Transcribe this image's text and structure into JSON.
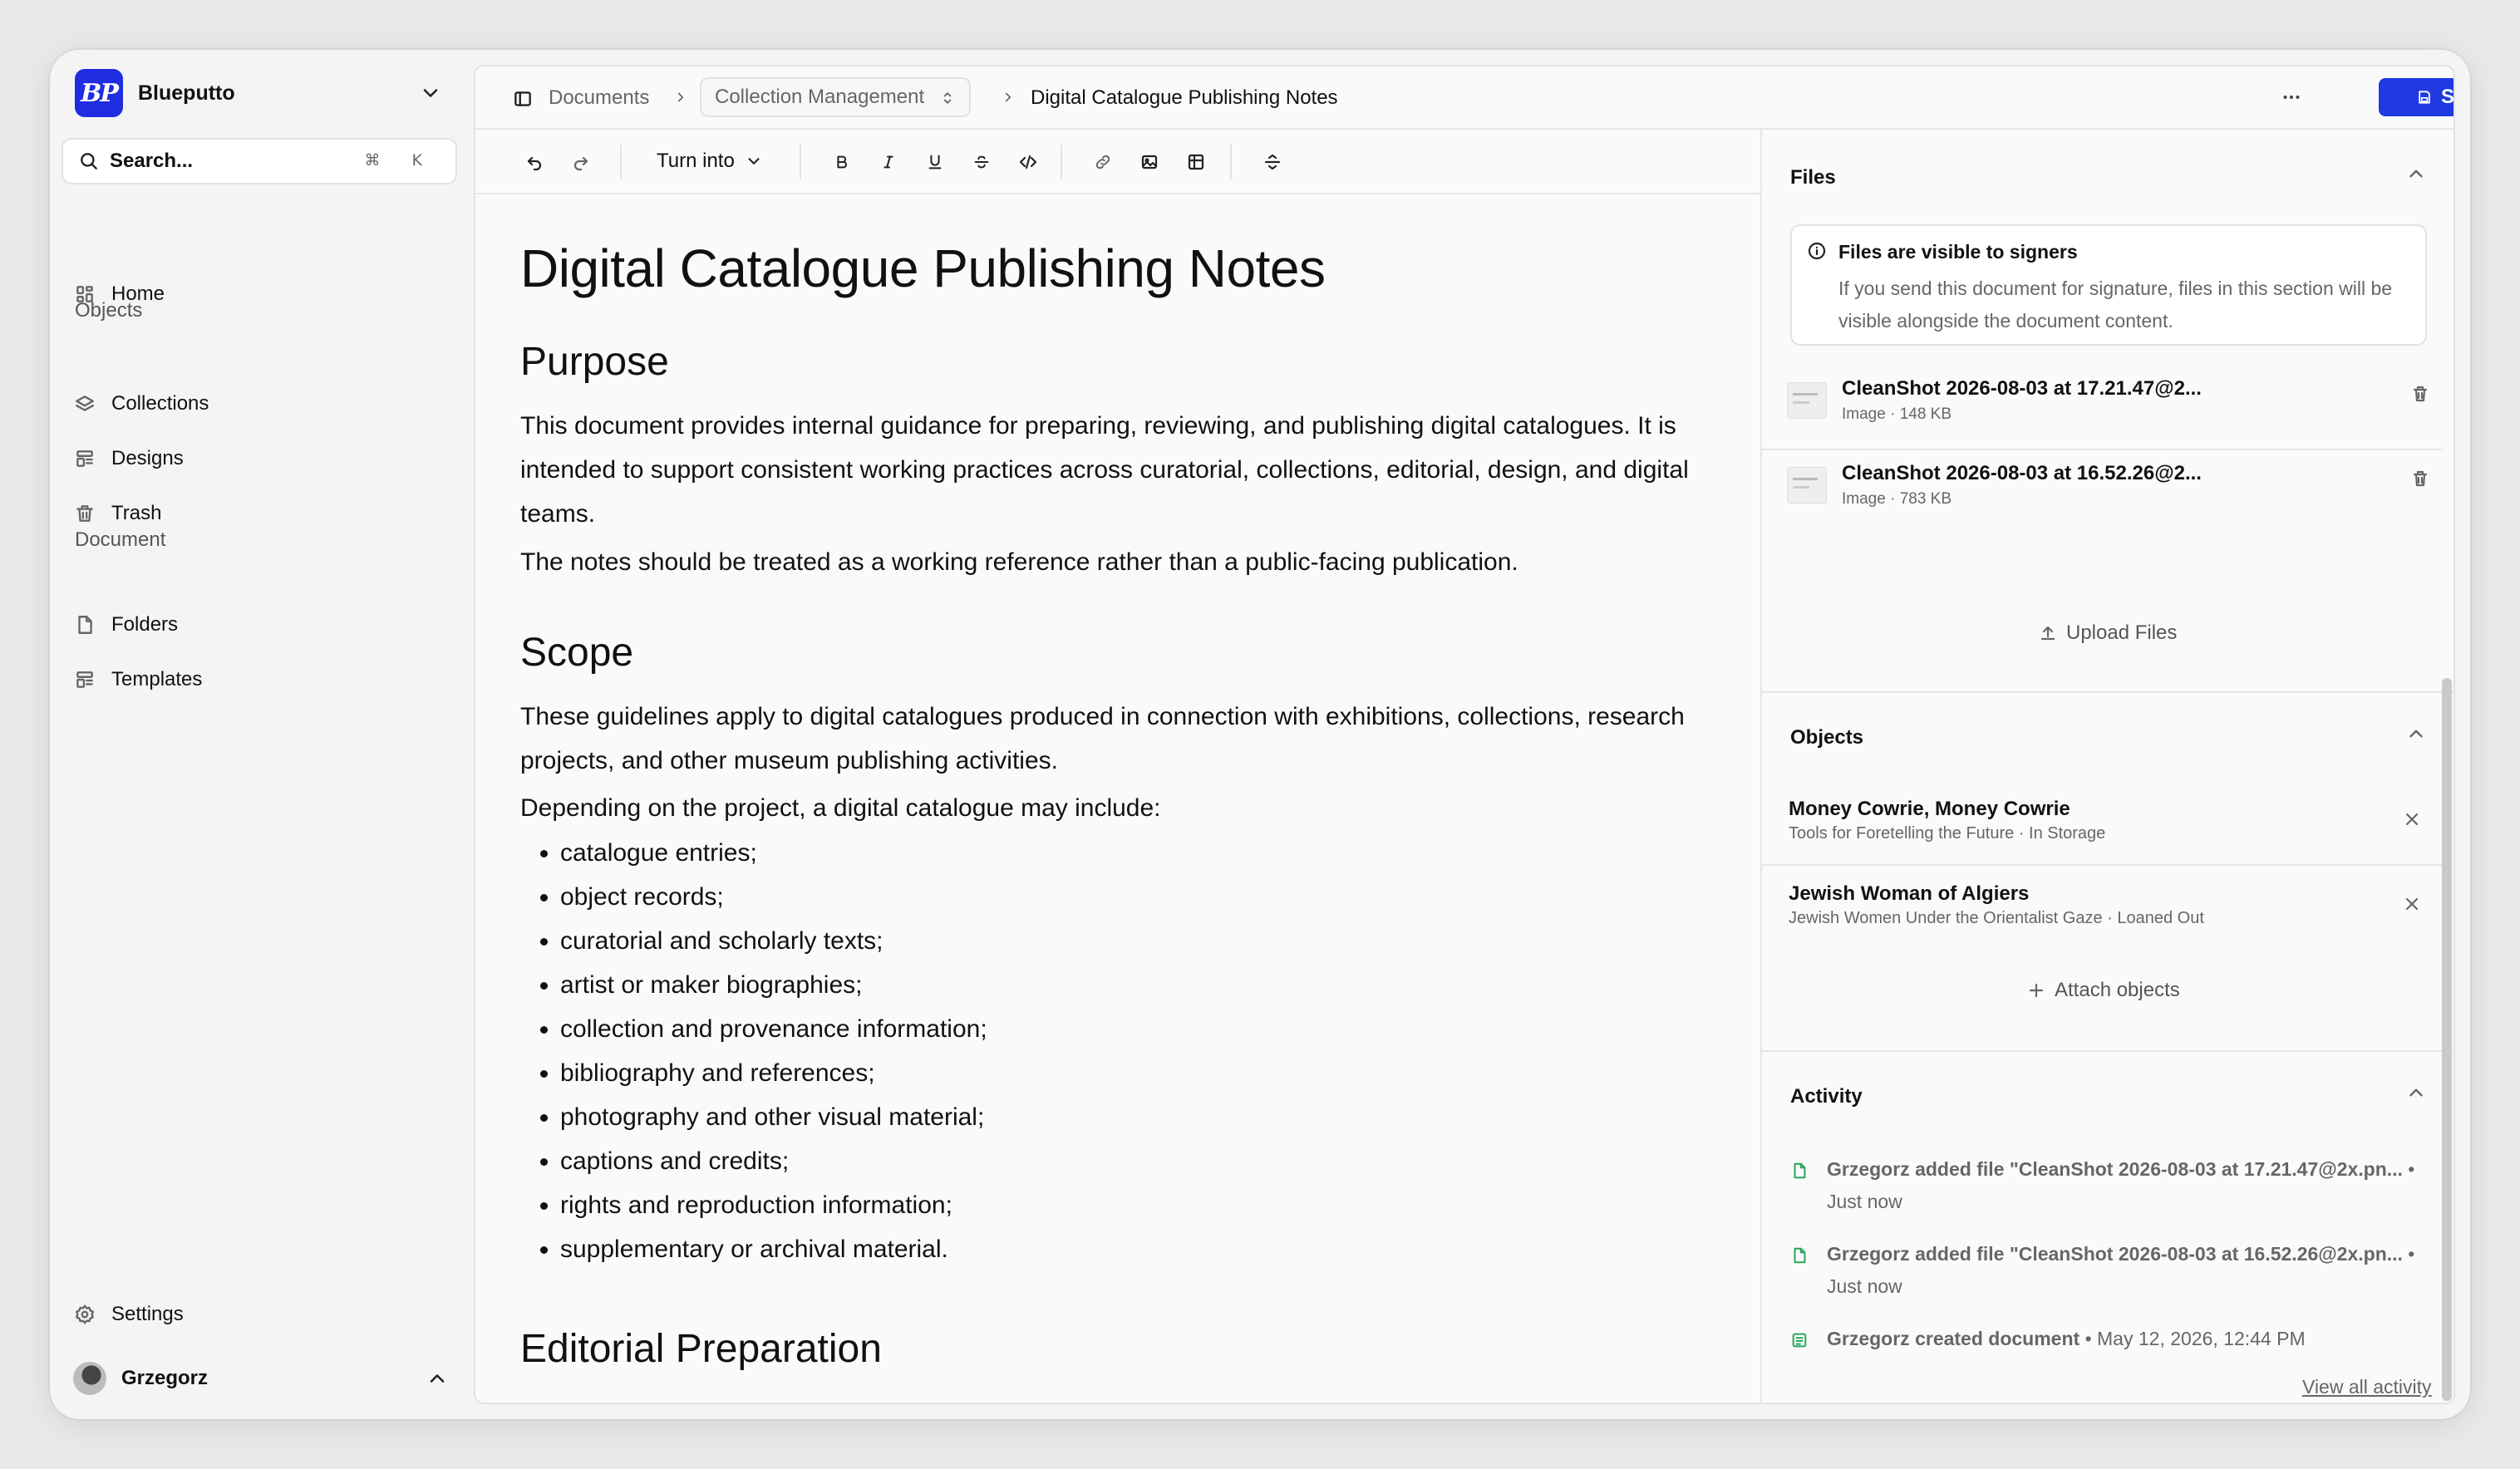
{
  "brand": {
    "name": "Blueputto",
    "logo_text": "BP"
  },
  "search": {
    "label": "Search...",
    "shortcut": "⌘ K"
  },
  "sidebar": {
    "home": "Home",
    "objects_section": "Objects",
    "collections": "Collections",
    "designs": "Designs",
    "trash": "Trash",
    "document_section": "Document",
    "folders": "Folders",
    "templates": "Templates",
    "settings": "Settings",
    "user": "Grzegorz"
  },
  "breadcrumb": {
    "root": "Documents",
    "collection": "Collection Management",
    "current": "Digital Catalogue Publishing Notes"
  },
  "topbar": {
    "save_label": "Save",
    "more_label": "···"
  },
  "toolbar": {
    "turn_into": "Turn into"
  },
  "document": {
    "title": "Digital Catalogue Publishing Notes",
    "h_purpose": "Purpose",
    "p_purpose_1": "This document provides internal guidance for preparing, reviewing, and publishing digital catalogues. It is intended to support consistent working practices across curatorial, collections, editorial, design, and digital teams.",
    "p_purpose_2": "The notes should be treated as a working reference rather than a public-facing publication.",
    "h_scope": "Scope",
    "p_scope_1": "These guidelines apply to digital catalogues produced in connection with exhibitions, collections, research projects, and other museum publishing activities.",
    "p_scope_2": "Depending on the project, a digital catalogue may include:",
    "scope_list": [
      "catalogue entries;",
      "object records;",
      "curatorial and scholarly texts;",
      "artist or maker biographies;",
      "collection and provenance information;",
      "bibliography and references;",
      "photography and other visual material;",
      "captions and credits;",
      "rights and reproduction information;",
      "supplementary or archival material."
    ],
    "h_editorial": "Editorial Preparation"
  },
  "files": {
    "title": "Files",
    "notice_title": "Files are visible to signers",
    "notice_body": "If you send this document for signature, files in this section will be visible alongside the document content.",
    "items": [
      {
        "name": "CleanShot 2026-08-03 at 17.21.47@2...",
        "meta": "Image · 148 KB"
      },
      {
        "name": "CleanShot 2026-08-03 at 16.52.26@2...",
        "meta": "Image · 783 KB"
      }
    ],
    "upload_label": "Upload Files"
  },
  "objects": {
    "title": "Objects",
    "items": [
      {
        "name": "Money Cowrie, Money Cowrie",
        "meta": "Tools for Foretelling the Future · In Storage"
      },
      {
        "name": "Jewish Woman of Algiers",
        "meta": "Jewish Women Under the Orientalist Gaze · Loaned Out"
      }
    ],
    "attach_label": "Attach objects"
  },
  "activity": {
    "title": "Activity",
    "items": [
      {
        "text": "Grzegorz added file \"CleanShot 2026-08-03 at 17.21.47@2x.pn...",
        "time": " • Just now"
      },
      {
        "text": "Grzegorz added file \"CleanShot 2026-08-03 at 16.52.26@2x.pn...",
        "time": " • Just now"
      },
      {
        "text": "Grzegorz created document",
        "time": " • May 12, 2026, 12:44 PM"
      }
    ],
    "view_all": "View all activity"
  },
  "colors": {
    "accent": "#1e3ae0",
    "brand": "#1e2de0",
    "activity_icon": "#2aa55a"
  }
}
